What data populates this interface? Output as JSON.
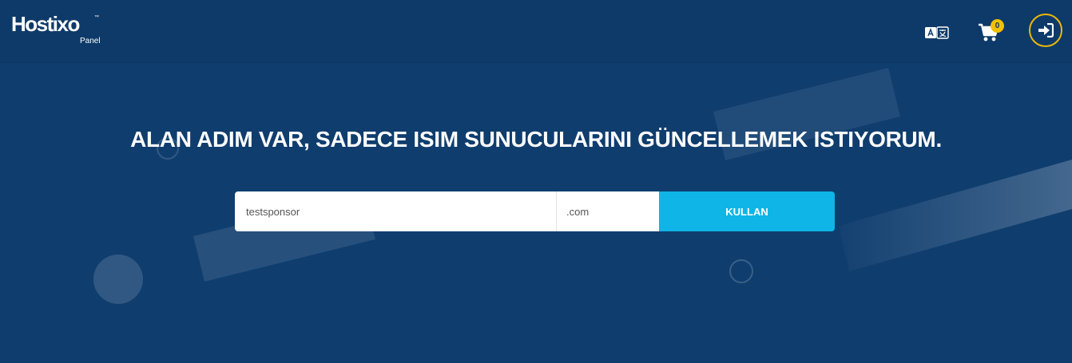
{
  "header": {
    "logo_text": "Hostixo",
    "logo_tm": "™",
    "logo_sub": "Panel",
    "cart_count": "0"
  },
  "hero": {
    "title": "ALAN ADIM VAR, SADECE ISIM SUNUCULARINI GÜNCELLEMEK ISTIYORUM."
  },
  "search": {
    "domain_value": "testsponsor",
    "tld_value": ".com",
    "submit_label": "KULLAN"
  },
  "colors": {
    "background": "#0f3d6e",
    "header": "#0e3a69",
    "accent": "#0eb5e6",
    "badge": "#f2c100",
    "login_ring": "#e9b80c"
  },
  "icons": [
    "translate-icon",
    "cart-icon",
    "sign-in-icon"
  ]
}
